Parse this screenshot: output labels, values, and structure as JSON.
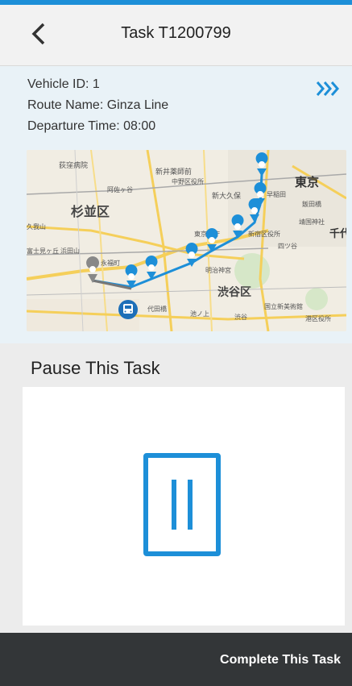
{
  "header": {
    "title": "Task T1200799"
  },
  "vehicle": {
    "vehicle_id_line": "Vehicle ID:  1",
    "route_name_line": "Route Name:  Ginza Line",
    "departure_time_line": "Departure Time:  08:00"
  },
  "map": {
    "labels": {
      "suginami": "杉並区",
      "shibuya": "渋谷区",
      "tokyo": "東京",
      "ogikubo_hospital": "荻窪病院",
      "shin_igiya": "新井薬師前",
      "nakano": "中野区役所",
      "shin_okubo": "新大久保",
      "asagaya": "阿佐ヶ谷",
      "koenji": "高円寺",
      "kugayama": "久我山",
      "eifukucho": "永福町",
      "hamadayama": "浜田山",
      "fujimigaoka": "富士見ヶ丘",
      "tochoumae": "東京都庁",
      "meijijingu": "明治神宮",
      "shinjuku_ku": "新宿区役所",
      "yotsuya": "四ツ谷",
      "kokuritsu": "国立新美術館",
      "ikejiri": "池ノ上",
      "daitabashi": "代田橋",
      "waseda": "早稲田",
      "iidabashi": "飯田橋",
      "yasukuni": "靖国神社",
      "chiyoda": "千代",
      "minato": "港区役所",
      "shibuya_st": "渋谷"
    },
    "accent_color": "#1d8fd8"
  },
  "pause_section": {
    "title": "Pause This Task"
  },
  "footer": {
    "complete_label": "Complete This Task"
  },
  "colors": {
    "accent": "#1d8fd8",
    "footer_bg": "#333638",
    "info_bg": "#e9f2f7"
  }
}
